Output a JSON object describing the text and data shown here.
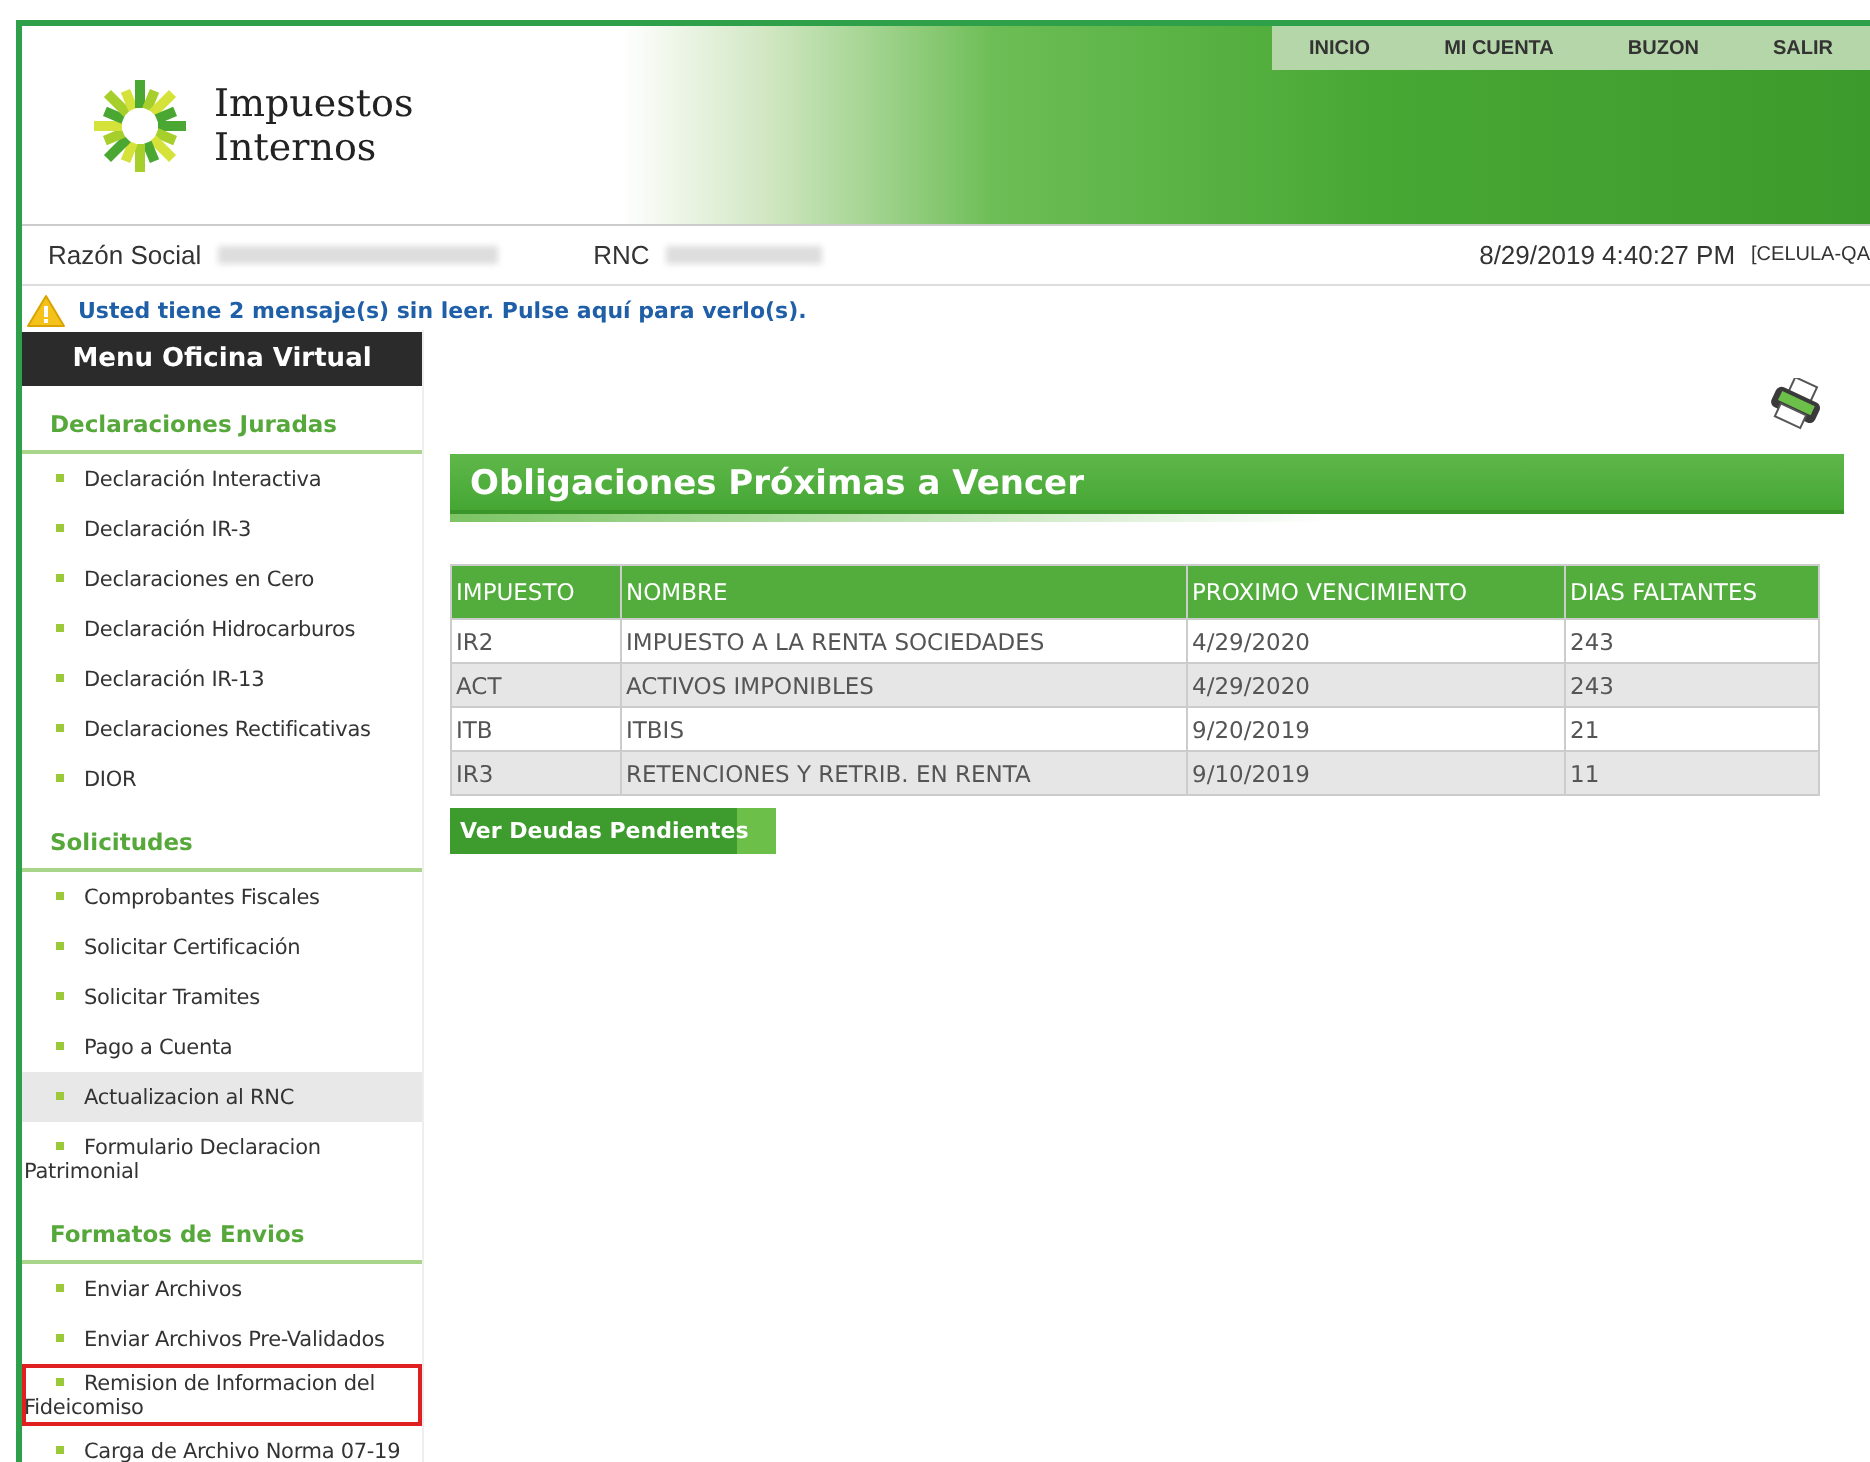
{
  "header": {
    "logo_text": [
      "Impuestos",
      "Internos"
    ],
    "nav": [
      "INICIO",
      "MI CUENTA",
      "BUZON",
      "SALIR"
    ]
  },
  "info_bar": {
    "company_label": "Razón Social",
    "rnc_label": "RNC",
    "datetime": "8/29/2019 4:40:27 PM",
    "user": "[CELULA-QA"
  },
  "notice": {
    "text": "Usted tiene 2 mensaje(s) sin leer. Pulse aquí para verlo(s)."
  },
  "sidebar": {
    "title": "Menu Oficina Virtual",
    "sections": [
      {
        "title": "Declaraciones Juradas",
        "items": [
          {
            "label": "Declaración Interactiva",
            "selected": false,
            "highlighted": false
          },
          {
            "label": "Declaración IR-3",
            "selected": false,
            "highlighted": false
          },
          {
            "label": "Declaraciones en Cero",
            "selected": false,
            "highlighted": false
          },
          {
            "label": "Declaración Hidrocarburos",
            "selected": false,
            "highlighted": false
          },
          {
            "label": "Declaración IR-13",
            "selected": false,
            "highlighted": false
          },
          {
            "label": "Declaraciones Rectificativas",
            "selected": false,
            "highlighted": false
          },
          {
            "label": "DIOR",
            "selected": false,
            "highlighted": false
          }
        ]
      },
      {
        "title": "Solicitudes",
        "items": [
          {
            "label": "Comprobantes Fiscales",
            "selected": false,
            "highlighted": false
          },
          {
            "label": "Solicitar Certificación",
            "selected": false,
            "highlighted": false
          },
          {
            "label": "Solicitar Tramites",
            "selected": false,
            "highlighted": false
          },
          {
            "label": "Pago a Cuenta",
            "selected": false,
            "highlighted": false
          },
          {
            "label": "Actualizacion al RNC",
            "selected": true,
            "highlighted": false
          },
          {
            "label": "Formulario Declaracion Patrimonial",
            "selected": false,
            "highlighted": false
          }
        ]
      },
      {
        "title": "Formatos de Envios",
        "items": [
          {
            "label": "Enviar Archivos",
            "selected": false,
            "highlighted": false
          },
          {
            "label": "Enviar Archivos Pre-Validados",
            "selected": false,
            "highlighted": false
          },
          {
            "label": "Remision de Informacion del Fideicomiso",
            "selected": false,
            "highlighted": true
          },
          {
            "label": "Carga de Archivo Norma 07-19",
            "selected": false,
            "highlighted": false
          }
        ]
      }
    ]
  },
  "main": {
    "title": "Obligaciones Próximas a Vencer",
    "table": {
      "columns": [
        "IMPUESTO",
        "NOMBRE",
        "PROXIMO VENCIMIENTO",
        "DIAS FALTANTES"
      ],
      "rows": [
        [
          "IR2",
          "IMPUESTO A LA RENTA SOCIEDADES",
          "4/29/2020",
          "243"
        ],
        [
          "ACT",
          "ACTIVOS IMPONIBLES",
          "4/29/2020",
          "243"
        ],
        [
          "ITB",
          "ITBIS",
          "9/20/2019",
          "21"
        ],
        [
          "IR3",
          "RETENCIONES Y RETRIB. EN RENTA",
          "9/10/2019",
          "11"
        ]
      ]
    },
    "button": "Ver Deudas Pendientes"
  }
}
